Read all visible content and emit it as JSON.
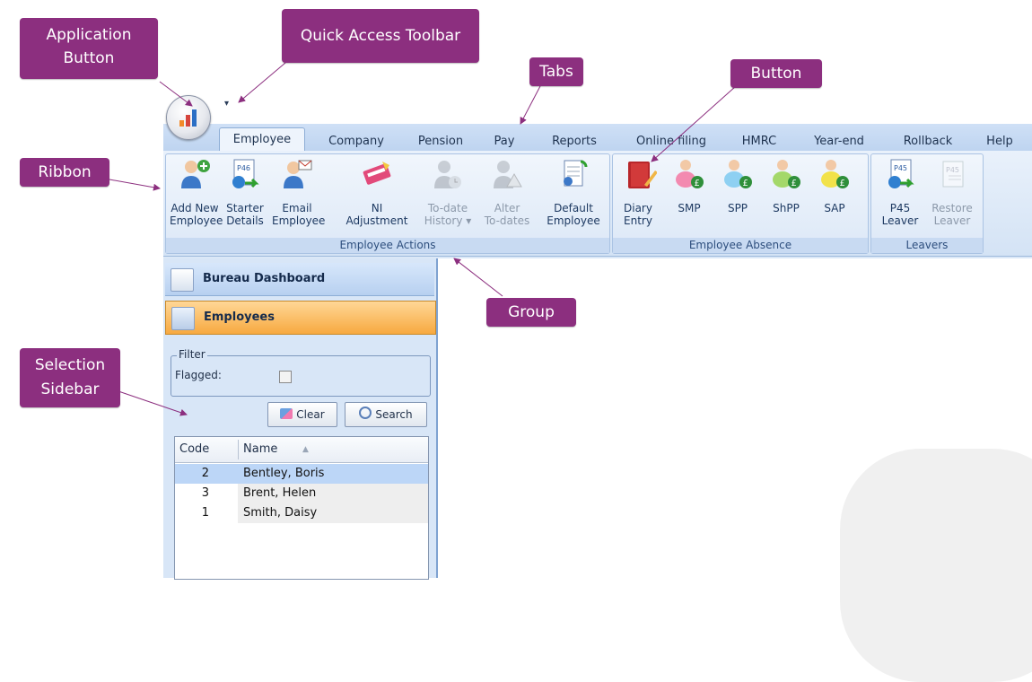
{
  "callouts": {
    "application_button": "Application Button",
    "quick_access_toolbar": "Quick Access Toolbar",
    "tabs": "Tabs",
    "button": "Button",
    "ribbon": "Ribbon",
    "group": "Group",
    "selection_sidebar": "Selection Sidebar"
  },
  "tabs": [
    "Employee",
    "Company",
    "Pension",
    "Pay",
    "Reports",
    "Online filing",
    "HMRC",
    "Year-end",
    "Rollback",
    "Help"
  ],
  "active_tab": "Employee",
  "ribbon": {
    "groups": [
      {
        "label": "Employee Actions",
        "buttons": [
          {
            "label1": "Add New",
            "label2": "Employee",
            "icon": "add-employee-icon"
          },
          {
            "label1": "Starter",
            "label2": "Details",
            "icon": "p46-document-icon"
          },
          {
            "label1": "Email",
            "label2": "Employee",
            "icon": "email-employee-icon"
          },
          {
            "label1": "NI",
            "label2": "Adjustment",
            "icon": "ni-card-icon"
          },
          {
            "label1": "To-date",
            "label2": "History ▾",
            "icon": "history-icon",
            "disabled": true
          },
          {
            "label1": "Alter",
            "label2": "To-dates",
            "icon": "alter-todates-icon",
            "disabled": true
          },
          {
            "label1": "Default",
            "label2": "Employee",
            "icon": "default-employee-icon"
          }
        ]
      },
      {
        "label": "Employee Absence",
        "buttons": [
          {
            "label1": "Diary",
            "label2": "Entry",
            "icon": "diary-icon"
          },
          {
            "label1": "SMP",
            "label2": "",
            "icon": "smp-baby-icon"
          },
          {
            "label1": "SPP",
            "label2": "",
            "icon": "spp-baby-icon"
          },
          {
            "label1": "ShPP",
            "label2": "",
            "icon": "shpp-baby-icon"
          },
          {
            "label1": "SAP",
            "label2": "",
            "icon": "sap-baby-icon"
          }
        ]
      },
      {
        "label": "Leavers",
        "buttons": [
          {
            "label1": "P45",
            "label2": "Leaver",
            "icon": "p45-leaver-icon"
          },
          {
            "label1": "Restore",
            "label2": "Leaver",
            "icon": "p45-restore-icon",
            "disabled": true
          }
        ]
      }
    ]
  },
  "sidebar": {
    "bureau_dashboard": "Bureau Dashboard",
    "employees": "Employees",
    "filter_legend": "Filter",
    "flagged_label": "Flagged:",
    "clear_button": "Clear",
    "search_button": "Search",
    "grid": {
      "col_code": "Code",
      "col_name": "Name",
      "rows": [
        {
          "code": "2",
          "name": "Bentley, Boris"
        },
        {
          "code": "3",
          "name": "Brent, Helen"
        },
        {
          "code": "1",
          "name": "Smith, Daisy"
        }
      ]
    }
  },
  "colors": {
    "callout": "#8c2f7f",
    "selected_row": "#bcd6f7",
    "active_nav": "#f7a940"
  }
}
